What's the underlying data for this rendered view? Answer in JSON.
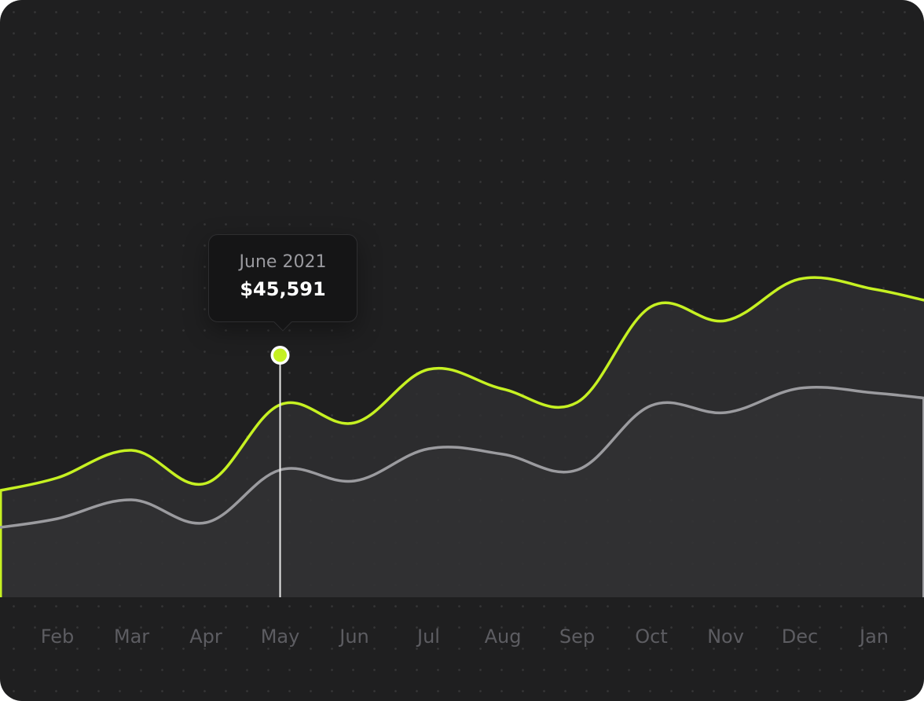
{
  "colors": {
    "background": "#1f1f20",
    "primary_line": "#c6f122",
    "secondary_line": "#9b9b9f",
    "area_fill": "#2f2f31",
    "axis_label": "#5d5d62"
  },
  "tooltip": {
    "date": "June 2021",
    "value": "$45,591"
  },
  "chart_data": {
    "type": "area",
    "categories": [
      "Feb",
      "Mar",
      "Apr",
      "May",
      "Jun",
      "Jul",
      "Aug",
      "Sep",
      "Oct",
      "Nov",
      "Dec",
      "Jan"
    ],
    "highlighted_category": "May",
    "grid": "dots",
    "series": [
      {
        "color": "#c6f122",
        "values": [
          152,
          187,
          145,
          245,
          222,
          290,
          265,
          248,
          370,
          352,
          405,
          392
        ]
      },
      {
        "color": "#9b9b9f",
        "values": [
          100,
          124,
          95,
          162,
          148,
          189,
          182,
          162,
          244,
          235,
          266,
          260
        ]
      }
    ],
    "ylim": [
      0,
      760
    ]
  }
}
